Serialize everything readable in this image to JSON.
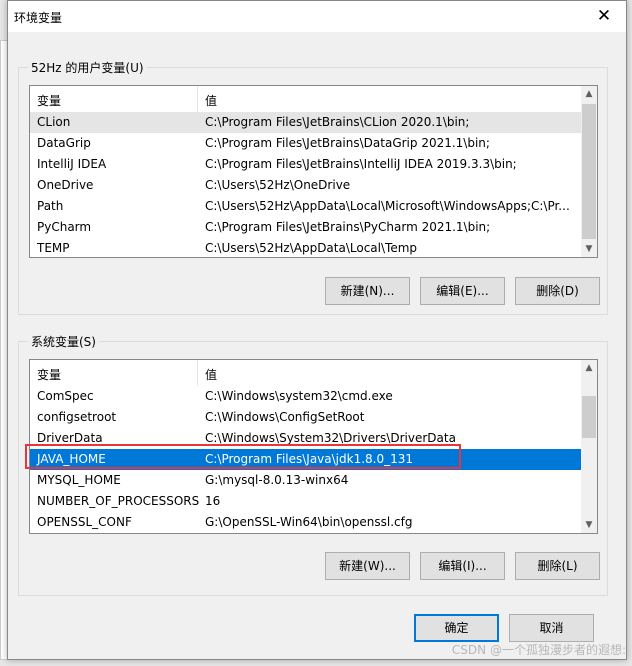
{
  "window": {
    "title": "环境变量",
    "close": "✕"
  },
  "user_vars": {
    "label": "52Hz 的用户变量(U)",
    "columns": [
      "变量",
      "值"
    ],
    "rows": [
      [
        "CLion",
        "C:\\Program Files\\JetBrains\\CLion 2020.1\\bin;"
      ],
      [
        "DataGrip",
        "C:\\Program Files\\JetBrains\\DataGrip 2021.1\\bin;"
      ],
      [
        "IntelliJ IDEA",
        "C:\\Program Files\\JetBrains\\IntelliJ IDEA 2019.3.3\\bin;"
      ],
      [
        "OneDrive",
        "C:\\Users\\52Hz\\OneDrive"
      ],
      [
        "Path",
        "C:\\Users\\52Hz\\AppData\\Local\\Microsoft\\WindowsApps;C:\\Pr..."
      ],
      [
        "PyCharm",
        "C:\\Program Files\\JetBrains\\PyCharm 2021.1\\bin;"
      ],
      [
        "TEMP",
        "C:\\Users\\52Hz\\AppData\\Local\\Temp"
      ]
    ],
    "buttons": {
      "new": "新建(N)...",
      "edit": "编辑(E)...",
      "delete": "删除(D)"
    }
  },
  "system_vars": {
    "label": "系统变量(S)",
    "columns": [
      "变量",
      "值"
    ],
    "rows": [
      [
        "ComSpec",
        "C:\\Windows\\system32\\cmd.exe"
      ],
      [
        "configsetroot",
        "C:\\Windows\\ConfigSetRoot"
      ],
      [
        "DriverData",
        "C:\\Windows\\System32\\Drivers\\DriverData"
      ],
      [
        "JAVA_HOME",
        "C:\\Program Files\\Java\\jdk1.8.0_131"
      ],
      [
        "MYSQL_HOME",
        "G:\\mysql-8.0.13-winx64"
      ],
      [
        "NUMBER_OF_PROCESSORS",
        "16"
      ],
      [
        "OPENSSL_CONF",
        "G:\\OpenSSL-Win64\\bin\\openssl.cfg"
      ]
    ],
    "selected": "JAVA_HOME",
    "buttons": {
      "new": "新建(W)...",
      "edit": "编辑(I)...",
      "delete": "删除(L)"
    }
  },
  "footer": {
    "ok": "确定",
    "cancel": "取消"
  },
  "watermark": "CSDN @一个孤独漫步者的遐想:",
  "colors": {
    "selection": "#0078d7",
    "highlight_box": "#e8353b"
  }
}
